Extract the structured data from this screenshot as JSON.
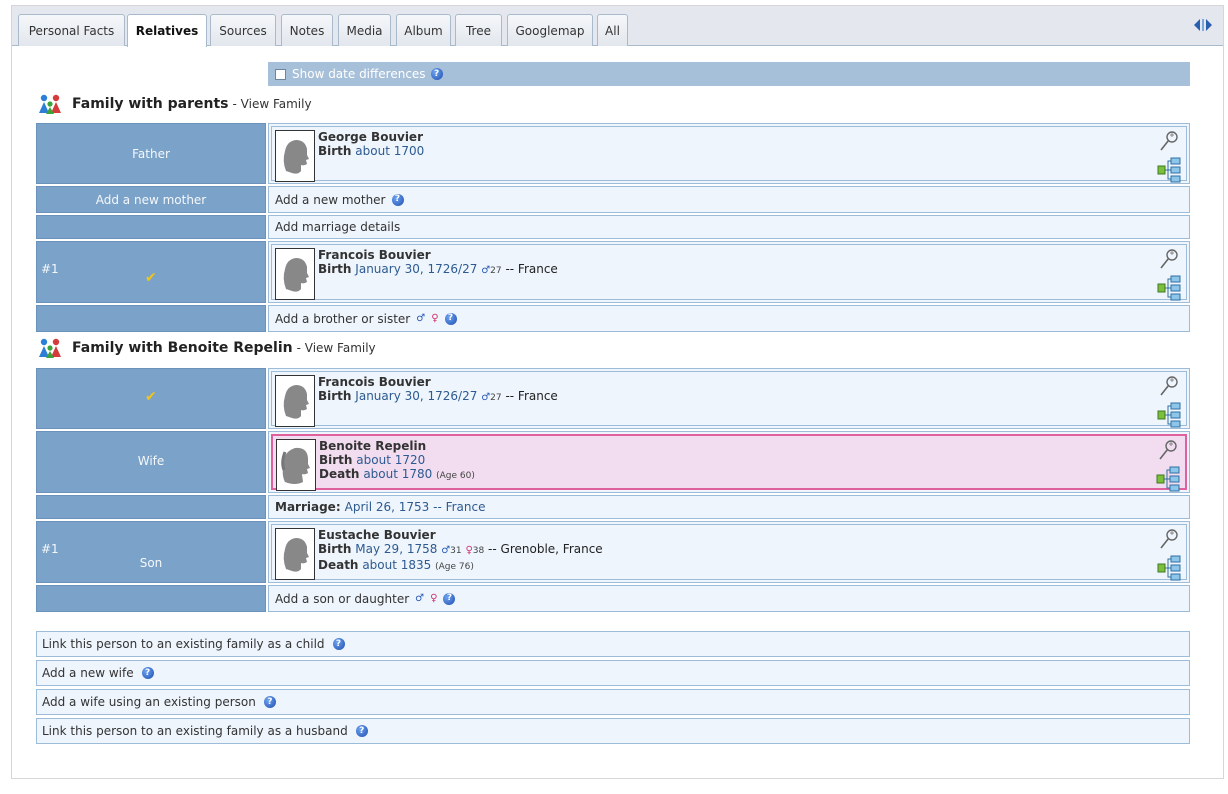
{
  "tabs": [
    {
      "label": "Personal Facts",
      "active": false
    },
    {
      "label": "Relatives",
      "active": true
    },
    {
      "label": "Sources",
      "active": false
    },
    {
      "label": "Notes",
      "active": false
    },
    {
      "label": "Media",
      "active": false
    },
    {
      "label": "Album",
      "active": false
    },
    {
      "label": "Tree",
      "active": false
    },
    {
      "label": "Googlemap",
      "active": false
    },
    {
      "label": "All",
      "active": false
    }
  ],
  "date_differences": {
    "label": "Show date differences",
    "checked": false
  },
  "family_parents": {
    "heading": "Family with parents",
    "view_link": "- View Family",
    "father_label": "Father",
    "father": {
      "name": "George Bouvier",
      "birth_label": "Birth",
      "birth_value": "about 1700"
    },
    "add_mother_label": "Add a new mother",
    "add_mother_text": "Add a new mother",
    "add_marriage_text": "Add marriage details",
    "child_number": "#1",
    "child": {
      "name": "Francois Bouvier",
      "birth_label": "Birth",
      "birth_value": "January 30, 1726/27",
      "father_age": "27",
      "place": "-- France"
    },
    "add_sibling_text": "Add a brother or sister"
  },
  "family_spouse": {
    "heading": "Family with Benoite Repelin",
    "view_link": "- View Family",
    "self": {
      "name": "Francois Bouvier",
      "birth_label": "Birth",
      "birth_value": "January 30, 1726/27",
      "father_age": "27",
      "place": "-- France"
    },
    "wife_label": "Wife",
    "wife": {
      "name": "Benoite Repelin",
      "birth_label": "Birth",
      "birth_value": "about 1720",
      "death_label": "Death",
      "death_value": "about 1780",
      "death_age": "(Age 60)"
    },
    "marriage_label": "Marriage:",
    "marriage_value": "April 26, 1753 -- France",
    "child_number": "#1",
    "child_label": "Son",
    "child": {
      "name": "Eustache Bouvier",
      "birth_label": "Birth",
      "birth_value": "May 29, 1758",
      "father_age": "31",
      "mother_age": "38",
      "place": "-- Grenoble, France",
      "death_label": "Death",
      "death_value": "about 1835",
      "death_age": "(Age 76)"
    },
    "add_child_text": "Add a son or daughter"
  },
  "bottom_actions": [
    "Link this person to an existing family as a child",
    "Add a new wife",
    "Add a wife using an existing person",
    "Link this person to an existing family as a husband"
  ],
  "symbols": {
    "male": "♂",
    "female": "♀",
    "check": "✔",
    "help": "?"
  },
  "colors": {
    "header_cell": "#7ba2c8",
    "content_cell": "#eef5fd",
    "female_box": "#f2ddf0",
    "female_border": "#e0609e",
    "date_bar": "#a7c0d9"
  },
  "icons": [
    "family-icon",
    "zoom-icon",
    "tree-chart-icon",
    "help-icon",
    "silhouette-icon",
    "toggle-panel-icon"
  ]
}
